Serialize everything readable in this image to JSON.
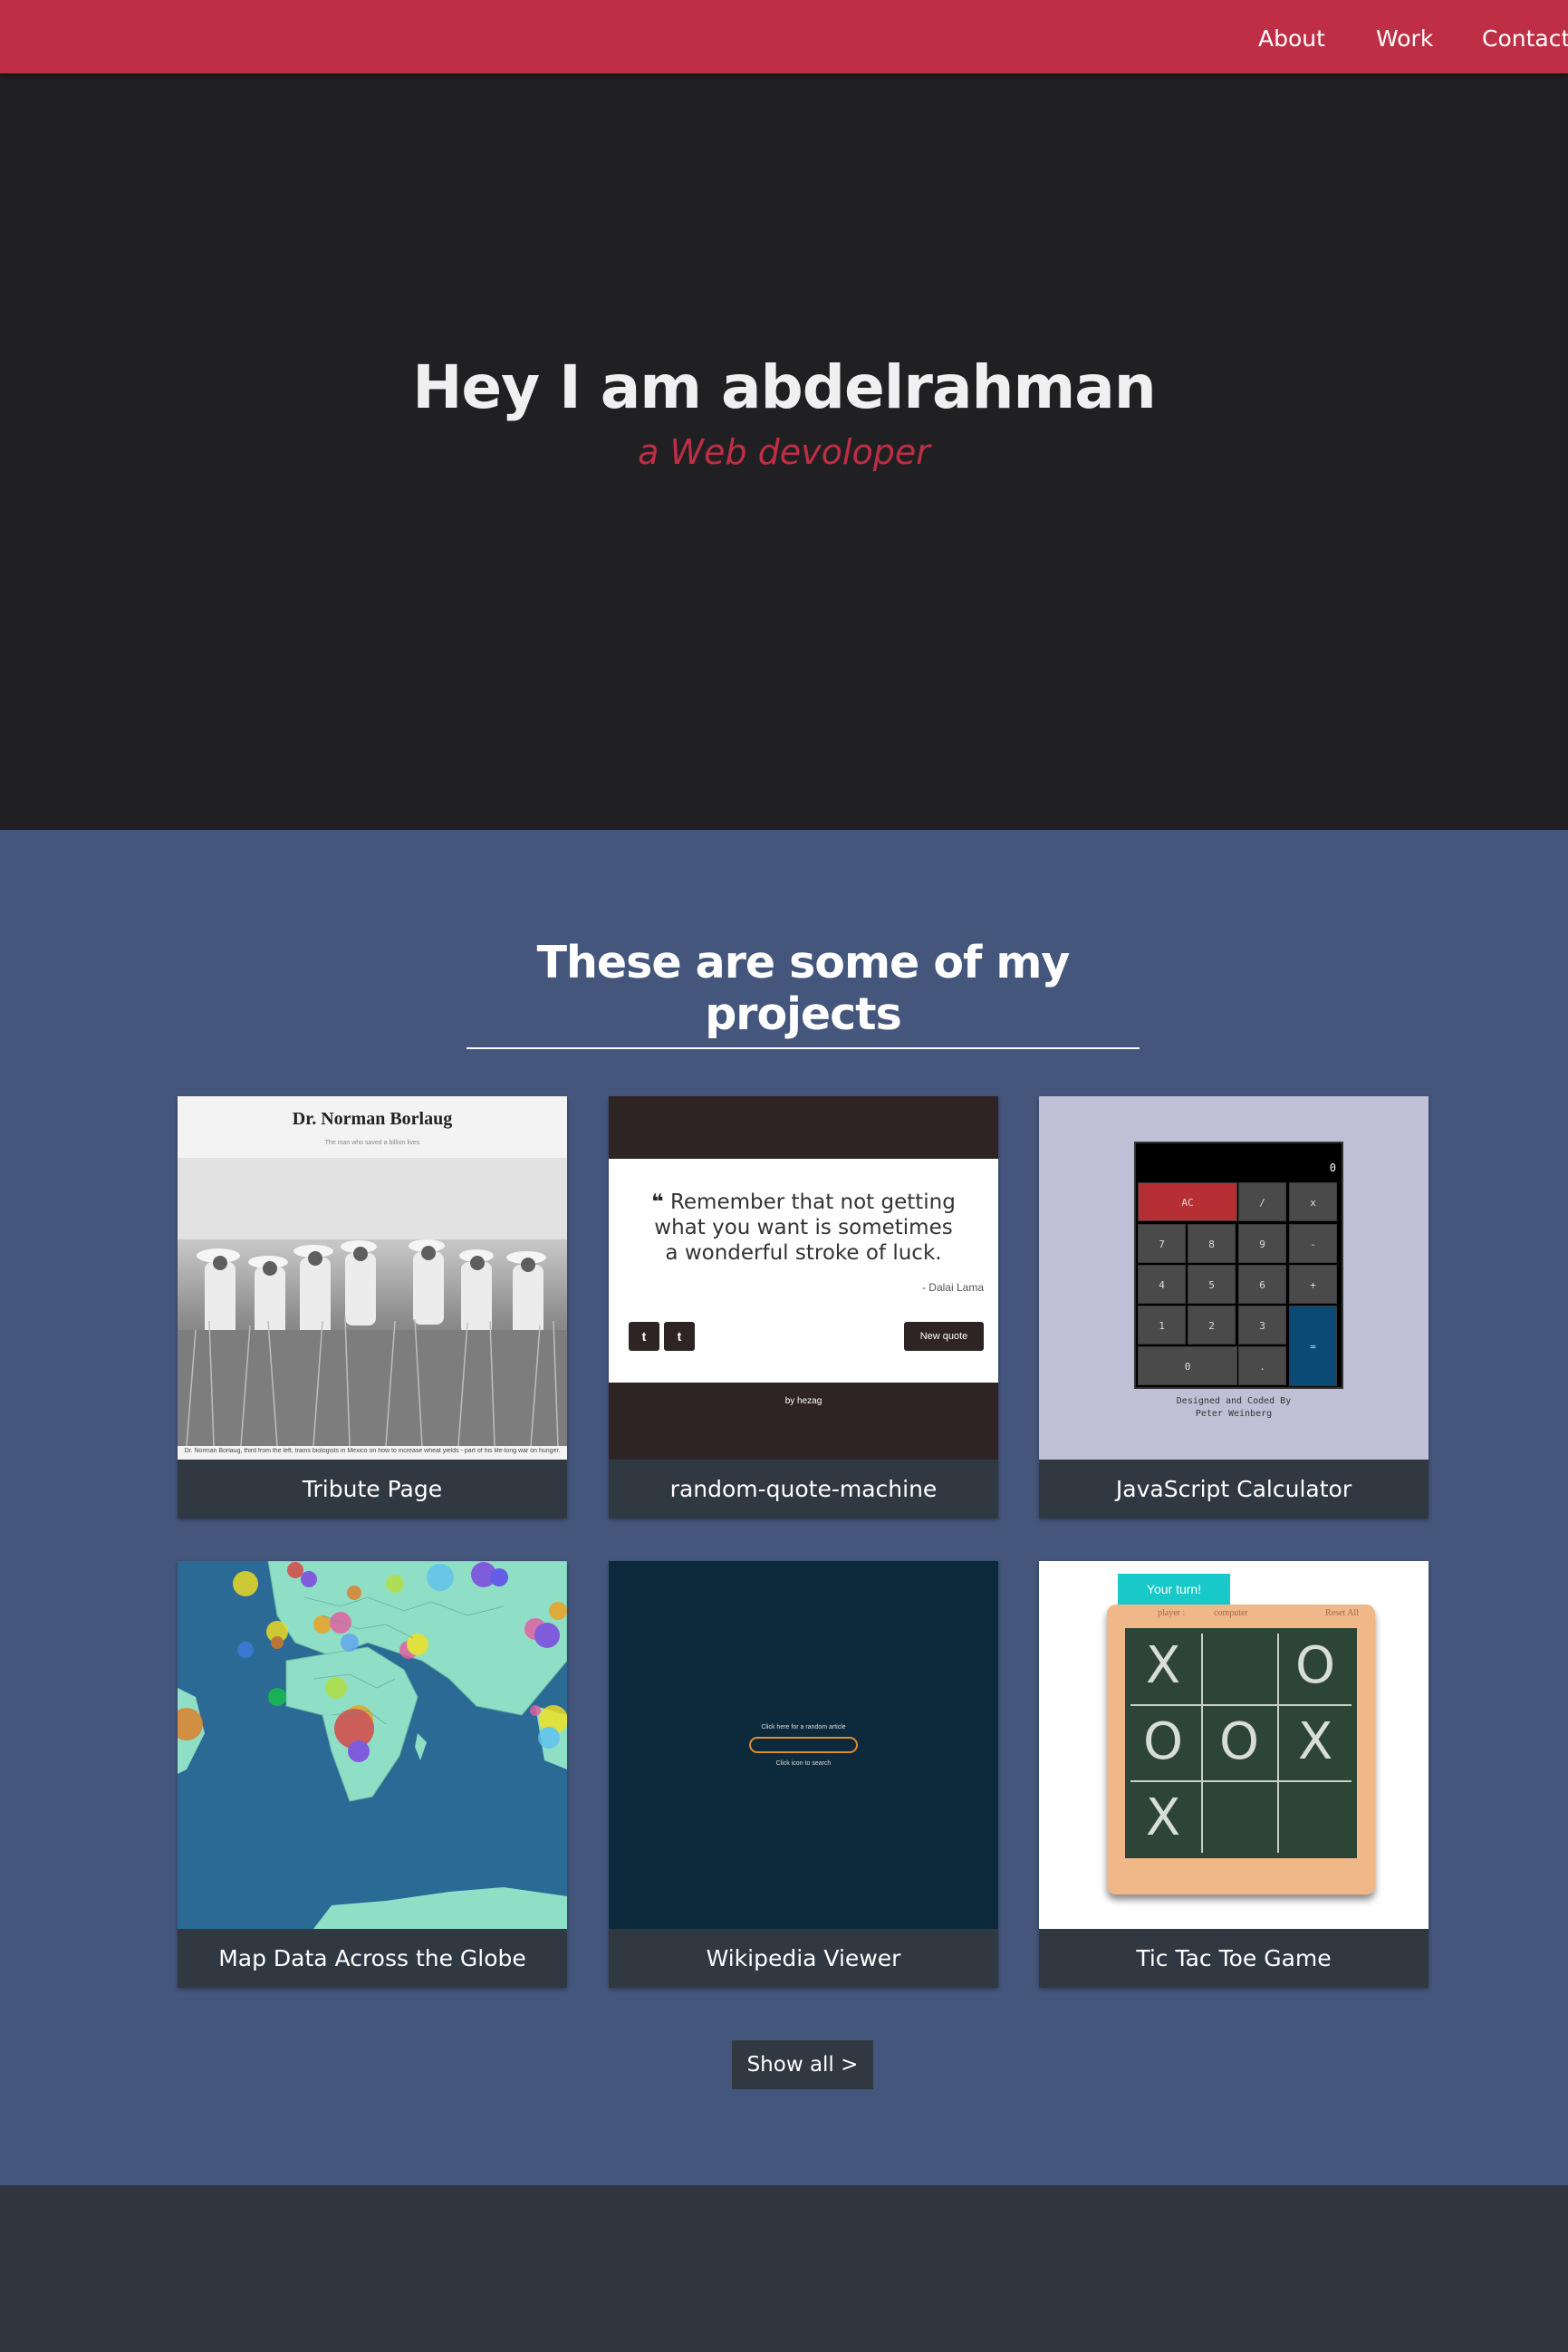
{
  "nav": {
    "about": "About",
    "work": "Work",
    "contact": "Contact"
  },
  "hero": {
    "title": "Hey I am abdelrahman",
    "subtitle": "a Web devoloper"
  },
  "projects": {
    "heading": "These are some of my projects",
    "show_all": "Show all >",
    "items": [
      {
        "label": "Tribute Page",
        "preview_title": "Dr. Norman Borlaug",
        "preview_subtitle": "The man who saved a billion lives",
        "preview_caption": "Dr. Norman Borlaug, third from the left, trains biologists in Mexico on how to increase wheat yields - part of his life-long war on hunger."
      },
      {
        "label": "random-quote-machine",
        "preview_quote": "Remember that not getting what you want is sometimes a wonderful stroke of luck.",
        "preview_quote_mark": "❝",
        "preview_author": "- Dalai Lama",
        "preview_tweet": "t",
        "preview_tumblr": "t",
        "preview_new_quote": "New quote",
        "preview_by": "by hezag"
      },
      {
        "label": "JavaScript Calculator",
        "preview_display": "0",
        "preview_keys": [
          "AC",
          "/",
          "x",
          "7",
          "8",
          "9",
          "-",
          "4",
          "5",
          "6",
          "+",
          "1",
          "2",
          "3",
          "=",
          "0",
          "."
        ],
        "preview_footer_1": "Designed and Coded By",
        "preview_footer_2": "Peter Weinberg"
      },
      {
        "label": "Map Data Across the Globe"
      },
      {
        "label": "Wikipedia Viewer",
        "preview_top": "Click here for a random article",
        "preview_bottom": "Click icon to search"
      },
      {
        "label": "Tic Tac Toe Game",
        "preview_turn": "Your turn!",
        "preview_player": "player :",
        "preview_computer": "computer",
        "preview_reset": "Reset All",
        "preview_cells": [
          "X",
          "",
          "O",
          "O",
          "O",
          "X",
          "X",
          "",
          ""
        ]
      }
    ]
  },
  "colors": {
    "nav": "#be2e45",
    "hero_bg": "#202023",
    "projects_bg": "#45567d",
    "tile_label_bg": "#303841",
    "footer_bg": "#30363f",
    "accent": "#be2e45"
  }
}
